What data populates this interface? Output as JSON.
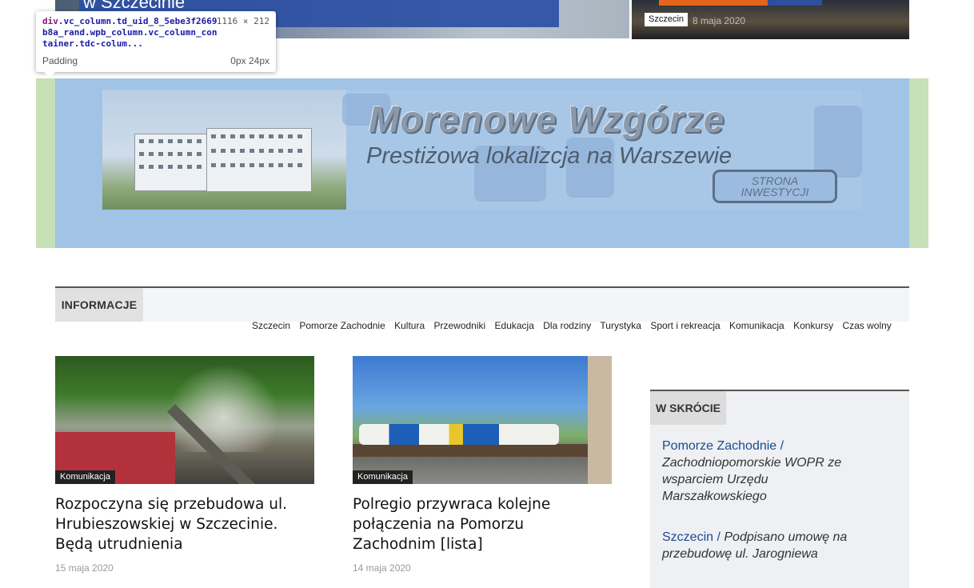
{
  "top_strip": {
    "left_title_fragment": "w Szczecinie",
    "right_category": "Szczecin",
    "right_date": "8 maja 2020"
  },
  "devtools": {
    "selector_tag": "div",
    "selector_rest": ".vc_column.td_uid_8_5ebe3f2669b8a_rand.wpb_column.vc_column_container.tdc-colum...",
    "dimensions": "1116 × 212",
    "prop_name": "Padding",
    "prop_value": "0px 24px"
  },
  "banner": {
    "headline": "Morenowe Wzgórze",
    "subline": "Prestiżowa lokalizcja na Warszewie",
    "button_line1": "STRONA",
    "button_line2": "INWESTYCJI"
  },
  "informacje": {
    "label": "INFORMACJE",
    "subnav": [
      "Szczecin",
      "Pomorze Zachodnie",
      "Kultura",
      "Przewodniki",
      "Edukacja",
      "Dla rodziny",
      "Turystyka",
      "Sport i rekreacja",
      "Komunikacja",
      "Konkursy",
      "Czas wolny"
    ]
  },
  "articles": [
    {
      "category": "Komunikacja",
      "title": "Rozpoczyna się przebudowa ul. Hrubieszowskiej w Szczecinie. Będą utrudnienia",
      "date": "15 maja 2020"
    },
    {
      "category": "Komunikacja",
      "title": "Polregio przywraca kolejne połączenia na Pomorzu Zachodnim [lista]",
      "date": "14 maja 2020"
    }
  ],
  "w_skrocie": {
    "label": "W SKRÓCIE",
    "items": [
      {
        "category": "Pomorze Zachodnie /",
        "text": "Zachodniopomorskie WOPR ze wsparciem Urzędu Marszałkowskiego"
      },
      {
        "category": "Szczecin /",
        "text": "Podpisano umowę na przebudowę ul. Jarogniewa"
      }
    ]
  },
  "colors": {
    "padding_highlight": "#c7e0b5",
    "content_highlight": "#a0c3e6",
    "link_blue": "#1a4b8c",
    "accent_orange": "#e5641b"
  }
}
